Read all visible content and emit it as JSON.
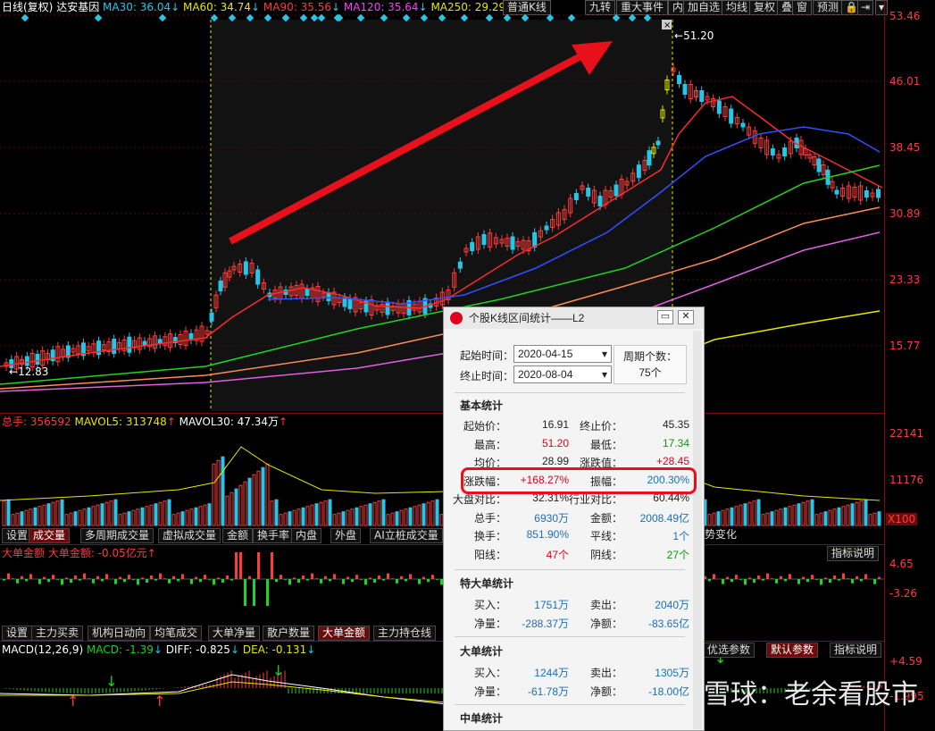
{
  "header": {
    "name": "日线(复权)",
    "stock": "达安基因",
    "ma30": "MA30: 36.04",
    "ma60": "MA60: 34.74",
    "ma90": "MA90: 35.56",
    "ma120": "MA120: 35.64",
    "ma250": "MA250: 29.29",
    "buttons": [
      "普通K线",
      "九转",
      "重大事件",
      "内",
      "加自选",
      "均线",
      "复权",
      "叠",
      "窗",
      "预测"
    ]
  },
  "price_axis": [
    "53.46",
    "46.01",
    "38.45",
    "30.89",
    "23.33",
    "15.77"
  ],
  "price_marks": {
    "high": "51.20",
    "low": "12.83"
  },
  "volume": {
    "label_total": "总手: 356592",
    "label_mavol5": "MAVOL5: 313748",
    "label_mavol30": "MAVOL30: 47.34万",
    "axis": [
      "22141",
      "11176",
      "X100"
    ],
    "tabs": [
      "设置",
      "成交量",
      "多周期成交量",
      "虚拟成交量",
      "金额",
      "换手率",
      "内盘",
      "外盘",
      "AI立桩成交量"
    ],
    "tab_extra": "势变化"
  },
  "big_order": {
    "label": "大单金额 大单金额: -0.05亿元",
    "axis": [
      "4.65",
      "-3.26"
    ],
    "help": "指标说明",
    "tabs": [
      "设置",
      "主力买卖",
      "机构日动向",
      "均笔成交",
      "大单净量",
      "散户数量",
      "大单金额",
      "主力持仓线"
    ]
  },
  "macd": {
    "label": "MACD(12,26,9)",
    "macd": "MACD: -1.39",
    "diff": "DIFF: -0.825",
    "dea": "DEA: -0.131",
    "axis": [
      "4.59",
      "-1.995"
    ],
    "tabs": [
      "优选参数",
      "默认参数",
      "指标说明"
    ]
  },
  "dialog": {
    "title": "个股K线区间统计——L2",
    "start_label": "起始时间：",
    "start_value": "2020-04-15",
    "end_label": "终止时间：",
    "end_value": "2020-08-04",
    "period_label": "周期个数：",
    "period_value": "75个",
    "basic_title": "基本统计",
    "basic": [
      [
        "起始价：",
        "16.91",
        "终止价：",
        "45.35"
      ],
      [
        "最高：",
        "51.20",
        "最低：",
        "17.34"
      ],
      [
        "均价：",
        "28.99",
        "涨跌值：",
        "+28.45"
      ],
      [
        "涨跌幅：",
        "+168.27%",
        "振幅：",
        "200.30%"
      ],
      [
        "大盘对比：",
        "32.31%",
        "行业对比：",
        "60.44%"
      ],
      [
        "总手：",
        "6930万",
        "金额：",
        "2008.49亿"
      ],
      [
        "换手：",
        "851.90%",
        "平线：",
        "1个"
      ],
      [
        "阳线：",
        "47个",
        "阴线：",
        "27个"
      ]
    ],
    "special_title": "特大单统计",
    "special": [
      [
        "买入：",
        "1751万",
        "卖出：",
        "2040万"
      ],
      [
        "净量：",
        "-288.37万",
        "净额：",
        "-83.65亿"
      ]
    ],
    "large_title": "大单统计",
    "large": [
      [
        "买入：",
        "1244万",
        "卖出：",
        "1305万"
      ],
      [
        "净量：",
        "-61.78万",
        "净额：",
        "-18.00亿"
      ]
    ],
    "mid_title": "中单统计"
  },
  "watermark": "雪球：老余看股市",
  "colors": {
    "up": "#ff3b3b",
    "down": "#27c6e8",
    "ma5": "#ff2a2a",
    "ma30": "#3050ff",
    "ma60": "#22d322",
    "ma120": "#ff8a5a",
    "ma250": "#e060e0"
  }
}
